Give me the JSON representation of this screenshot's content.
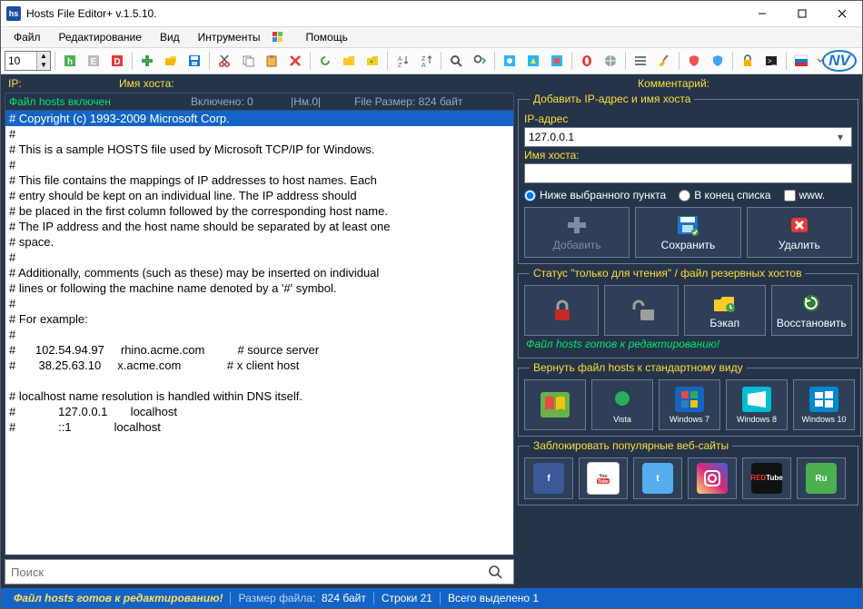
{
  "window": {
    "title": "Hosts File Editor+ v.1.5.10.",
    "icon_text": "hs"
  },
  "menu": {
    "file": "Файл",
    "edit": "Редактирование",
    "view": "Вид",
    "tools": "Интрументы",
    "help": "Помощь"
  },
  "toolbar": {
    "font_size": "10"
  },
  "headers": {
    "ip": "IP:",
    "host": "Имя хоста:",
    "comment": "Комментарий:"
  },
  "statusinfo": {
    "enabled": "Файл hosts включен",
    "included": "Включено: 0",
    "nm": "|Нм.0|",
    "filesize": "File Размер: 824 байт"
  },
  "hosts_lines": [
    "# Copyright (c) 1993-2009 Microsoft Corp.",
    "#",
    "# This is a sample HOSTS file used by Microsoft TCP/IP for Windows.",
    "#",
    "# This file contains the mappings of IP addresses to host names. Each",
    "# entry should be kept on an individual line. The IP address should",
    "# be placed in the first column followed by the corresponding host name.",
    "# The IP address and the host name should be separated by at least one",
    "# space.",
    "#",
    "# Additionally, comments (such as these) may be inserted on individual",
    "# lines or following the machine name denoted by a '#' symbol.",
    "#",
    "# For example:",
    "#",
    "#      102.54.94.97     rhino.acme.com          # source server",
    "#       38.25.63.10     x.acme.com              # x client host",
    "",
    "# localhost name resolution is handled within DNS itself.",
    "#             127.0.0.1       localhost",
    "#             ::1             localhost"
  ],
  "search": {
    "placeholder": "Поиск"
  },
  "panel_add": {
    "legend": "Добавить IP-адрес и имя хоста",
    "ip_label": "IP-адрес",
    "ip_value": "127.0.0.1",
    "host_label": "Имя хоста:",
    "radio_below": "Ниже выбранного пункта",
    "radio_end": "В конец списка",
    "check_www": "www.",
    "btn_add": "Добавить",
    "btn_save": "Сохранить",
    "btn_del": "Удалить"
  },
  "panel_readonly": {
    "legend": "Статус \"только для чтения\" / файл резервных хостов",
    "btn_backup": "Бэкап",
    "btn_restore": "Восстановить",
    "status": "Файл hosts готов к редактированию!"
  },
  "panel_default": {
    "legend": "Вернуть файл hosts к стандартному виду",
    "os": [
      "XP",
      "Vista",
      "Windows 7",
      "Windows 8",
      "Windows 10"
    ]
  },
  "panel_block": {
    "legend": "Заблокировать популярные веб-сайты",
    "sites": [
      "facebook",
      "youtube",
      "twitter",
      "instagram",
      "redtube",
      "rutracker"
    ]
  },
  "footer": {
    "ready": "Файл hosts готов к редактированию!",
    "size_label": "Размер файла:",
    "size_value": "824 байт",
    "lines": "Строки 21",
    "sel": "Всего выделено 1"
  }
}
